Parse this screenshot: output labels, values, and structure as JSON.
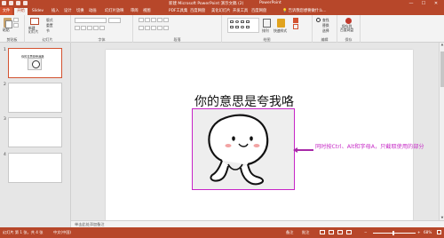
{
  "titlebar": {
    "doc_title": "新建 Microsoft PowerPoint 演示文稿 (2)",
    "app_name": "PowerPoint",
    "min": "—",
    "max": "☐",
    "close": "✕"
  },
  "tabs": [
    {
      "label": "文件"
    },
    {
      "label": "开始"
    },
    {
      "label": "Slidev"
    },
    {
      "label": "插入"
    },
    {
      "label": "设计"
    },
    {
      "label": "切换"
    },
    {
      "label": "动画"
    },
    {
      "label": "幻灯片放映"
    },
    {
      "label": "审阅"
    },
    {
      "label": "视图"
    },
    {
      "label": "PDF工具集"
    },
    {
      "label": "百度网盘"
    },
    {
      "label": "美化幻灯片"
    },
    {
      "label": "开发工具"
    },
    {
      "label": "百度网盘"
    }
  ],
  "tell_me": "告诉我您想要做什么...",
  "ribbon": {
    "clipboard": {
      "label": "剪贴板",
      "paste": "粘贴"
    },
    "slides": {
      "label": "幻灯片",
      "new_slide": "新建\n幻灯片",
      "layout": "版式",
      "reset": "重置",
      "section": "节"
    },
    "font": {
      "label": "字体"
    },
    "paragraph": {
      "label": "段落"
    },
    "drawing": {
      "label": "绘图",
      "arrange": "排列",
      "quick_styles": "快速样式"
    },
    "editing": {
      "label": "编辑",
      "find": "查找",
      "replace": "替换",
      "select": "选择"
    },
    "baidu": {
      "label": "保存",
      "save_to": "保存到\n百度网盘"
    }
  },
  "thumbnails": [
    {
      "num": "1",
      "title": "你的意思是夸我咯"
    },
    {
      "num": "2"
    },
    {
      "num": "3"
    },
    {
      "num": "4"
    }
  ],
  "slide": {
    "title": "你的意思是夸我咯"
  },
  "annotation": "同时按Ctrl、Alt和字母A，只截取使用的部分",
  "notes_placeholder": "单击此处添加备注",
  "status": {
    "slide_info": "幻灯片 第 1 张，共 4 张",
    "lang": "中文(中国)",
    "notes": "备注",
    "comments": "批注",
    "zoom": "68%"
  }
}
